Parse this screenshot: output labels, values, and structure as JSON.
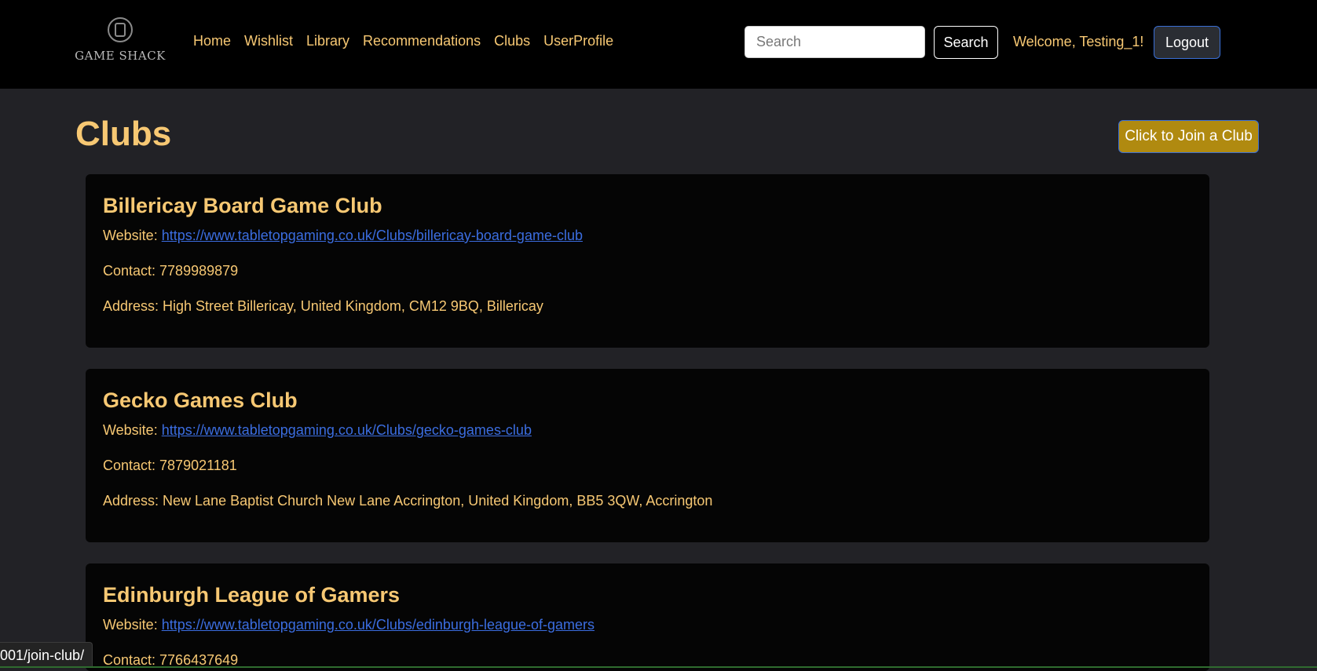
{
  "navbar": {
    "logo_text": "GAME SHACK",
    "links": [
      "Home",
      "Wishlist",
      "Library",
      "Recommendations",
      "Clubs",
      "UserProfile"
    ],
    "search_placeholder": "Search",
    "search_value": "",
    "search_button": "Search",
    "welcome": "Welcome, Testing_1!",
    "logout": "Logout"
  },
  "page": {
    "title": "Clubs",
    "join_button": "Click to Join a Club"
  },
  "clubs": [
    {
      "name": "Billericay Board Game Club",
      "website_label": "Website:",
      "website": "https://www.tabletopgaming.co.uk/Clubs/billericay-board-game-club",
      "contact": "Contact: 7789989879",
      "address": "Address: High Street Billericay, United Kingdom, CM12 9BQ, Billericay"
    },
    {
      "name": "Gecko Games Club",
      "website_label": "Website:",
      "website": "https://www.tabletopgaming.co.uk/Clubs/gecko-games-club",
      "contact": "Contact: 7879021181",
      "address": "Address: New Lane Baptist Church New Lane Accrington, United Kingdom, BB5 3QW, Accrington"
    },
    {
      "name": "Edinburgh League of Gamers",
      "website_label": "Website:",
      "website": "https://www.tabletopgaming.co.uk/Clubs/edinburgh-league-of-gamers",
      "contact": "Contact: 7766437649",
      "address": ""
    }
  ],
  "status_bar": {
    "url": "001/join-club/"
  },
  "colors": {
    "accent": "#f7c873",
    "link": "#3b6de0",
    "join_button": "#b08a10",
    "navbar": "#000000",
    "background": "#222226"
  }
}
